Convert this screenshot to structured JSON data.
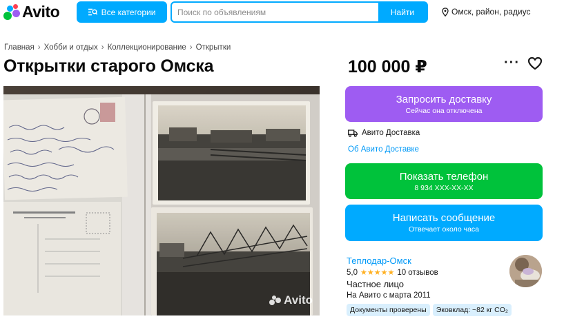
{
  "header": {
    "logo_text": "Avito",
    "categories_label": "Все категории",
    "search_placeholder": "Поиск по объявлениям",
    "search_button": "Найти",
    "location": "Омск, район, радиус"
  },
  "breadcrumb": [
    "Главная",
    "Хобби и отдых",
    "Коллекционирование",
    "Открытки"
  ],
  "listing": {
    "title": "Открытки старого Омска",
    "price": "100 000 ₽",
    "more_label": "···",
    "photo_watermark": "Avito"
  },
  "actions": {
    "delivery_main": "Запросить доставку",
    "delivery_sub": "Сейчас она отключена",
    "delivery_service": "Авито Доставка",
    "delivery_link": "Об Авито Доставке",
    "phone_main": "Показать телефон",
    "phone_sub": "8 934 XXX-XX-XX",
    "message_main": "Написать сообщение",
    "message_sub": "Отвечает около часа"
  },
  "seller": {
    "name": "Теплодар-Омск",
    "rating": "5,0",
    "stars": "★★★★★",
    "reviews": "10 отзывов",
    "type": "Частное лицо",
    "since": "На Авито с марта 2011",
    "badges": [
      "Документы проверены",
      "Эковклад: ~82 кг CO₂"
    ]
  },
  "colors": {
    "brand_blue": "#00aaff",
    "delivery_purple": "#9e5cf2",
    "phone_green": "#00c23b",
    "link_blue": "#0099f7",
    "star_yellow": "#ffb021"
  },
  "icons": {
    "logo": "avito-logo-icon",
    "categories": "search-categories-icon",
    "location": "location-pin-icon",
    "favorite": "heart-icon",
    "more": "more-icon",
    "delivery": "truck-icon"
  }
}
